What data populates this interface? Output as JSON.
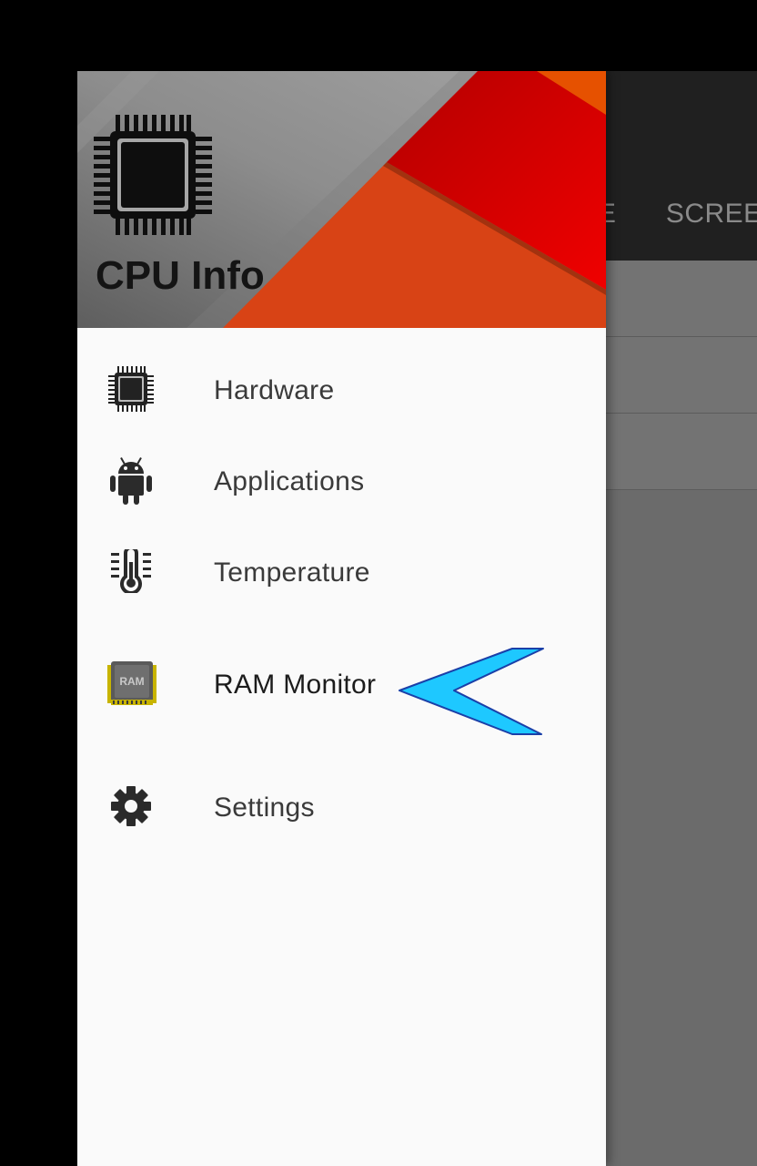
{
  "app": {
    "tabs": [
      "GE",
      "SCREEN"
    ]
  },
  "drawer": {
    "header": {
      "title": "CPU Info",
      "icon": "cpu-chip-icon"
    },
    "items": [
      {
        "label": "Hardware",
        "icon": "cpu-chip-icon"
      },
      {
        "label": "Applications",
        "icon": "android-icon"
      },
      {
        "label": "Temperature",
        "icon": "thermometer-icon"
      },
      {
        "label": "RAM Monitor",
        "icon": "ram-icon",
        "badge_text": "RAM"
      },
      {
        "label": "Settings",
        "icon": "gear-icon"
      }
    ]
  },
  "annotation": {
    "icon": "pointer-arrow-icon",
    "color": "#1ec8ff"
  },
  "colors": {
    "header_red": "#e40000",
    "header_orange": "#d84315",
    "header_gray": "#8a8a8a",
    "drawer_bg": "#fafafa",
    "toolbar_bg": "#202020"
  }
}
